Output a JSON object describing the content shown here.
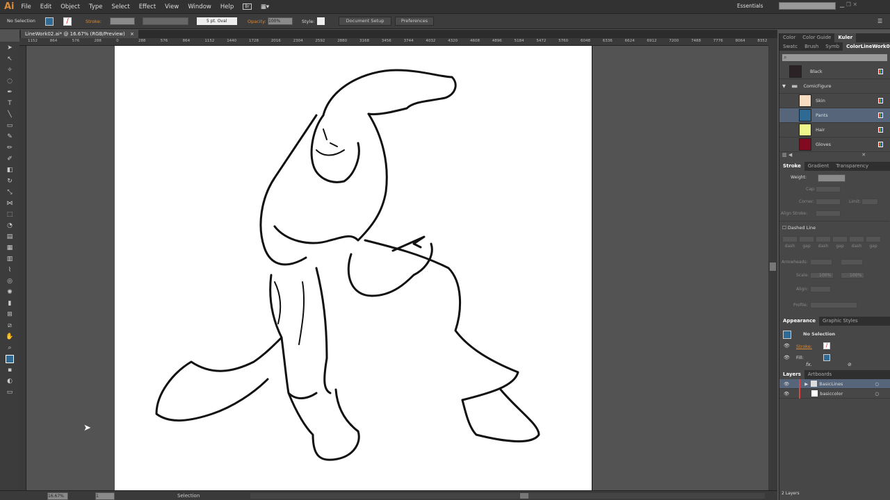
{
  "app": {
    "logo": "Ai",
    "menus": [
      "File",
      "Edit",
      "Object",
      "Type",
      "Select",
      "Effect",
      "View",
      "Window",
      "Help"
    ],
    "workspace": "Essentials",
    "search_placeholder": ""
  },
  "control": {
    "selection": "No Selection",
    "stroke_label": "Stroke:",
    "brush": "5 pt. Oval",
    "opacity_label": "Opacity:",
    "opacity": "100%",
    "style_label": "Style:",
    "document_setup": "Document Setup",
    "preferences": "Preferences",
    "fill_color": "#2f6a94"
  },
  "document": {
    "tab": "LineWork02.ai* @ 16.67% (RGB/Preview)",
    "close": "×",
    "ruler": [
      "1152",
      "864",
      "576",
      "288",
      "0",
      "288",
      "576",
      "864",
      "1152",
      "1440",
      "1728",
      "2016",
      "2304",
      "2592",
      "2880",
      "3168",
      "3456",
      "3744",
      "4032",
      "4320",
      "4608",
      "4896",
      "5184",
      "5472",
      "5760",
      "6048",
      "6336",
      "6624",
      "6912",
      "7200",
      "7488",
      "7776",
      "8064",
      "8352"
    ]
  },
  "status": {
    "zoom": "16.67%",
    "artboard": "1",
    "tool": "Selection"
  },
  "color_panel": {
    "tabs": [
      "Color",
      "Color Guide",
      "Kuler"
    ],
    "sub_tabs": [
      "Swatc",
      "Brush",
      "Symb",
      "ColorLineWork01"
    ],
    "swatches": [
      {
        "name": "Black",
        "color": "#2a2224"
      },
      {
        "name": "ComicFigure",
        "group": true
      },
      {
        "name": "Skin",
        "color": "#f8dcc0"
      },
      {
        "name": "Pants",
        "color": "#2f6a94",
        "selected": true
      },
      {
        "name": "Hair",
        "color": "#eef58a"
      },
      {
        "name": "Gloves",
        "color": "#820a20"
      }
    ]
  },
  "stroke_panel": {
    "tabs": [
      "Stroke",
      "Gradient",
      "Transparency"
    ],
    "weight": "Weight:",
    "cap": "Cap:",
    "corner": "Corner:",
    "limit": "Limit:",
    "align_stroke": "Align Stroke:",
    "dashed": "Dashed Line",
    "dash_labels": [
      "dash",
      "gap",
      "dash",
      "gap",
      "dash",
      "gap"
    ],
    "arrowheads": "Arrowheads:",
    "scale": "Scale:",
    "scale1": "100%",
    "scale2": "100%",
    "align": "Align:",
    "profile": "Profile:"
  },
  "appearance": {
    "tabs": [
      "Appearance",
      "Graphic Styles"
    ],
    "title": "No Selection",
    "stroke": "Stroke:",
    "fill": "Fill:",
    "fx": "fx."
  },
  "layers": {
    "tabs": [
      "Layers",
      "Artboards"
    ],
    "items": [
      "BasicLines",
      "basiccolor"
    ],
    "count": "2 Layers"
  }
}
